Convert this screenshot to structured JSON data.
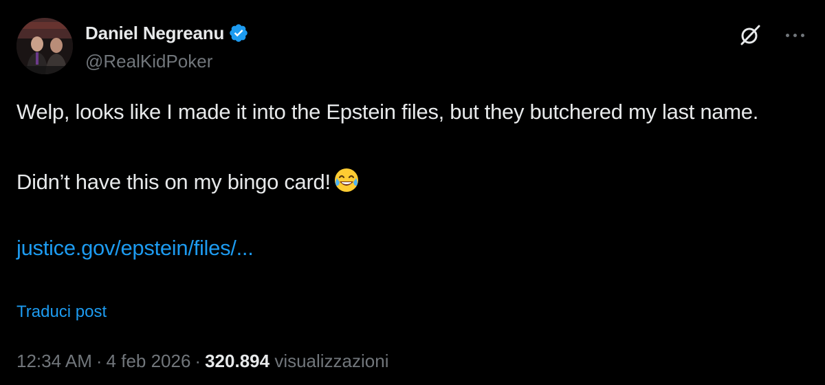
{
  "author": {
    "display_name": "Daniel Negreanu",
    "handle": "@RealKidPoker",
    "verified": true,
    "verified_color": "#1d9bf0"
  },
  "post": {
    "line1": "Welp, looks like I made it into the Epstein files, but they butchered my last name.",
    "line2": "Didn’t have this on my bingo card!",
    "emoji": "face-with-tears-of-joy",
    "link_text": "justice.gov/epstein/files/...",
    "translate_label": "Traduci post"
  },
  "meta": {
    "time": "12:34 AM",
    "separator": "·",
    "date": "4 feb 2026",
    "views_count": "320.894",
    "views_label": "visualizzazioni"
  },
  "icons": {
    "top_right_1": "grok-icon",
    "top_right_2": "more-icon"
  },
  "colors": {
    "background": "#000000",
    "text": "#e7e9ea",
    "secondary": "#71767b",
    "accent": "#1d9bf0"
  }
}
